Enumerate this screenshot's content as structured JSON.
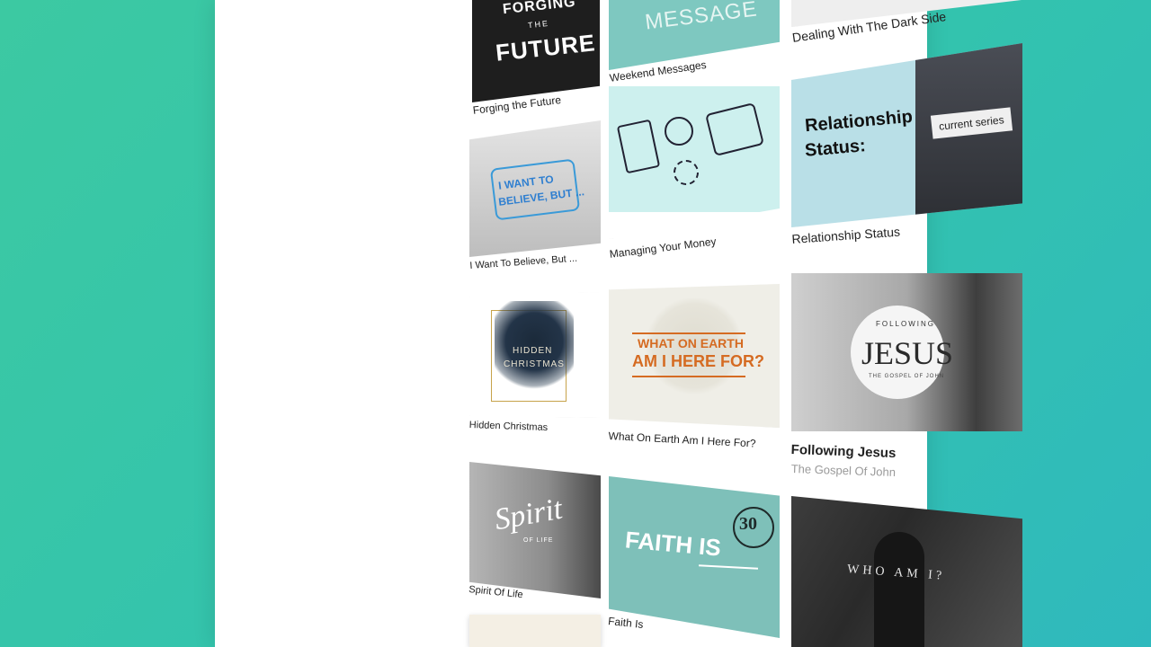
{
  "cards": [
    {
      "title": "Forging the Future",
      "art": [
        "FORGING",
        "THE",
        "FUTURE"
      ]
    },
    {
      "title": "Weekend Messages",
      "art": [
        "MESSAGE"
      ]
    },
    {
      "title": "Dealing With The Dark Side"
    },
    {
      "title": "I Want To Believe, But ...",
      "art": [
        "I WANT TO",
        "BELIEVE, BUT ..."
      ]
    },
    {
      "title": "Managing Your Money"
    },
    {
      "title": "Relationship Status",
      "art": [
        "Relationship",
        "Status:",
        "current series"
      ]
    },
    {
      "title": "Hidden Christmas",
      "art": [
        "HIDDEN",
        "CHRISTMAS"
      ]
    },
    {
      "title": "What On Earth Am I Here For?",
      "art": [
        "WHAT ON EARTH",
        "AM I HERE FOR?"
      ]
    },
    {
      "title": "Following Jesus",
      "subtitle": "The Gospel Of John",
      "art": [
        "FOLLOWING",
        "JESUS",
        "THE GOSPEL OF JOHN"
      ]
    },
    {
      "title": "Spirit Of Life",
      "art": [
        "Spirit",
        "OF LIFE"
      ]
    },
    {
      "title": "Faith Is",
      "art": [
        "FAITH IS",
        "30"
      ]
    },
    {
      "title": "",
      "art": [
        "WHO AM I?"
      ]
    }
  ]
}
